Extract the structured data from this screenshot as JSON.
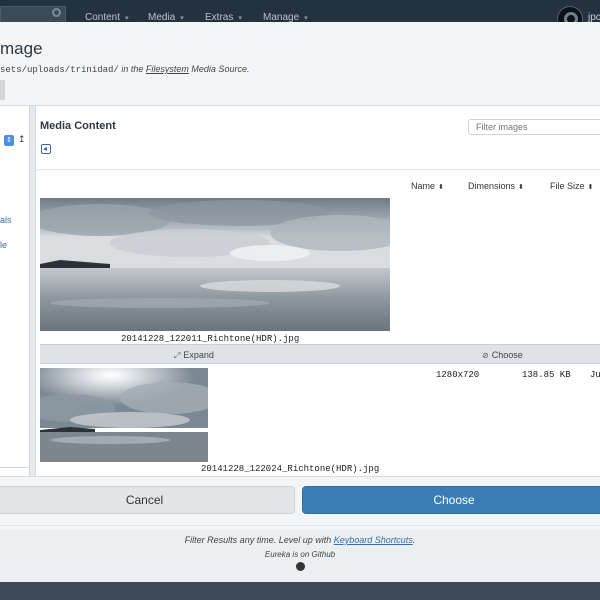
{
  "nav": {
    "items": [
      "Content",
      "Media",
      "Extras",
      "Manage"
    ],
    "user_fragment": "jpc"
  },
  "modal": {
    "title_fragment": "mage",
    "path_fragment": "sets/uploads/trinidad/",
    "subtitle_mid": "in the",
    "source_link": "Filesystem",
    "subtitle_end": "Media Source."
  },
  "tree": {
    "texts": [
      "als",
      "le"
    ]
  },
  "panel": {
    "title": "Media Content",
    "filter_placeholder": "Filter images",
    "columns": [
      "Name",
      "Dimensions",
      "File Size"
    ]
  },
  "files": [
    {
      "name": "20141228_122011_Richtone(HDR).jpg",
      "actions": [
        "Expand",
        "Choose"
      ]
    },
    {
      "name": "20141228_122024_Richtone(HDR).jpg",
      "dimensions": "1280x720",
      "size": "138.85 KB",
      "date_fragment": "Ju"
    }
  ],
  "buttons": {
    "cancel": "Cancel",
    "choose": "Choose"
  },
  "footer": {
    "pre": "Filter Results any time. Level up with",
    "link": "Keyboard Shortcuts",
    "post": ".",
    "eureka": "Eureka is on Github"
  },
  "colors": {
    "primary_button": "#3a7db5",
    "nav_bg": "#243240",
    "link": "#2e6fb0"
  }
}
